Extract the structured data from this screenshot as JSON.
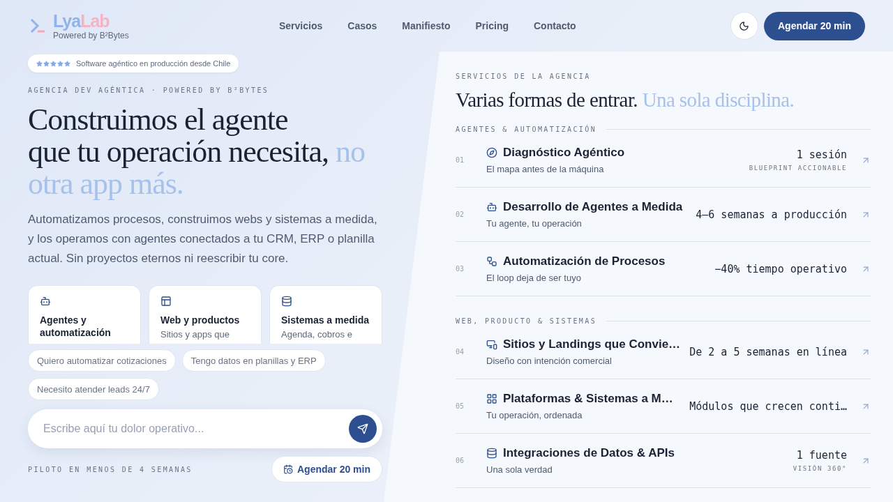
{
  "brand": {
    "name_start": "Lya",
    "name_end": "Lab",
    "tagline": "Powered by B²Bytes"
  },
  "nav": [
    "Servicios",
    "Casos",
    "Manifiesto",
    "Pricing",
    "Contacto"
  ],
  "header_cta": "Agendar 20 min",
  "hero": {
    "badge": {
      "stars": 5,
      "text": "Software agéntico en producción desde Chile"
    },
    "eyebrow": "AGENCIA DEV AGÉNTICA · POWERED BY B²BYTES",
    "headline_lines": [
      "Construimos el agente",
      "que tu operación necesita,"
    ],
    "headline_accent": "no otra app más.",
    "lead": "Automatizamos procesos, construimos webs y sistemas a medida, y los operamos con agentes conectados a tu CRM, ERP o planilla actual. Sin proyectos eternos ni reescribir tu core.",
    "cards": [
      {
        "title": "Agentes y automatización"
      },
      {
        "title": "Web y productos",
        "description": "Sitios y apps que"
      },
      {
        "title": "Sistemas a medida",
        "description": "Agenda, cobros e"
      }
    ],
    "chips": [
      "Quiero automatizar cotizaciones",
      "Tengo datos en planillas y ERP",
      "Necesito atender leads 24/7"
    ],
    "input": {
      "placeholder": "Escribe aquí tu dolor operativo..."
    },
    "footnote": "PILOTO EN MENOS DE 4 SEMANAS",
    "cta": "Agendar 20 min"
  },
  "services": {
    "eyebrow": "SERVICIOS DE LA AGENCIA",
    "title": "Varias formas de entrar.",
    "title_accent": "Una sola disciplina.",
    "groups": [
      {
        "label": "AGENTES & AUTOMATIZACIÓN",
        "items": [
          {
            "number": "01",
            "title": "Diagnóstico Agéntico",
            "subtitle": "El mapa antes de la máquina",
            "metric": "1 sesión",
            "metric_note": "BLUEPRINT ACCIONABLE"
          },
          {
            "number": "02",
            "title": "Desarrollo de Agentes a Medida",
            "subtitle": "Tu agente, tu operación",
            "metric": "4–6 semanas a producción"
          },
          {
            "number": "03",
            "title": "Automatización de Procesos",
            "subtitle": "El loop deja de ser tuyo",
            "metric": "−40% tiempo operativo"
          }
        ]
      },
      {
        "label": "WEB, PRODUCTO & SISTEMAS",
        "items": [
          {
            "number": "04",
            "title": "Sitios y Landings que Convie…",
            "subtitle": "Diseño con intención comercial",
            "metric": "De 2 a 5 semanas en línea"
          },
          {
            "number": "05",
            "title": "Plataformas & Sistemas a M…",
            "subtitle": "Tu operación, ordenada",
            "metric": "Módulos que crecen conti…"
          },
          {
            "number": "06",
            "title": "Integraciones de Datos & APIs",
            "subtitle": "Una sola verdad",
            "metric": "1 fuente",
            "metric_note": "VISIÓN 360°"
          }
        ]
      }
    ]
  }
}
